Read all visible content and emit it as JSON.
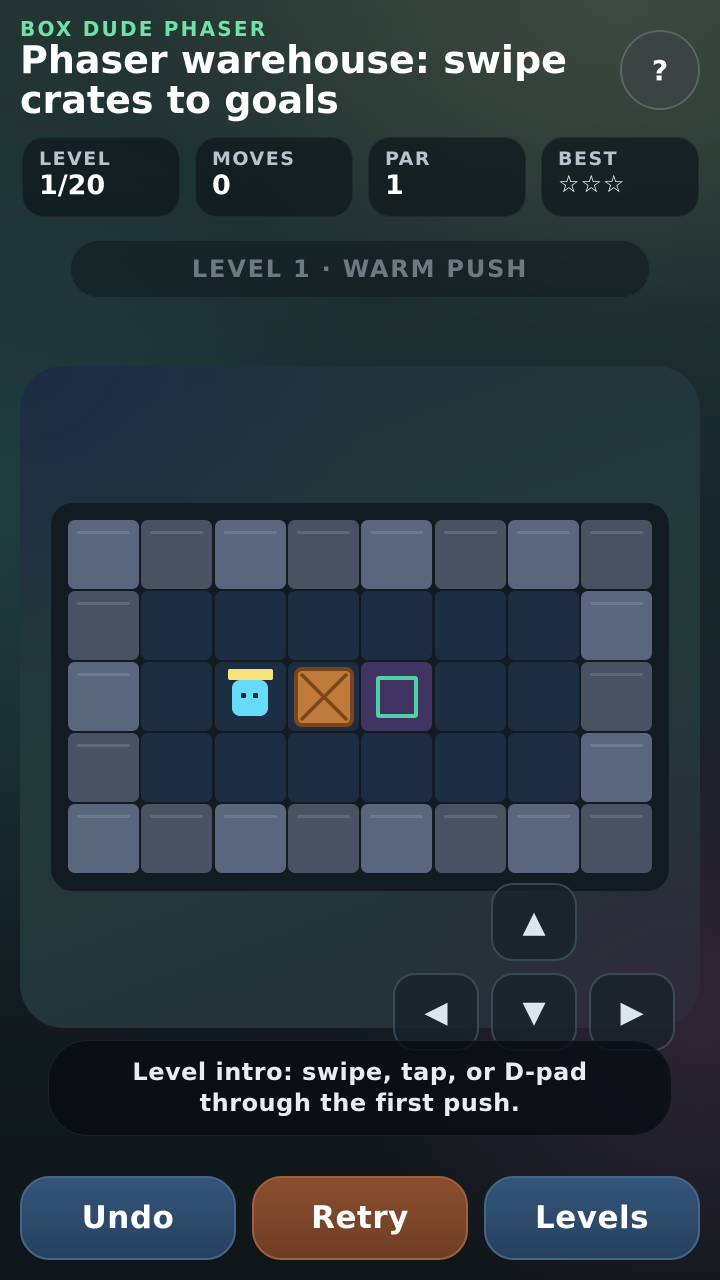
{
  "header": {
    "kicker": "BOX DUDE PHASER",
    "title": "Phaser warehouse: swipe crates to goals",
    "help_label": "?"
  },
  "stats": [
    {
      "label": "LEVEL",
      "value": "1/20"
    },
    {
      "label": "MOVES",
      "value": "0"
    },
    {
      "label": "PAR",
      "value": "1"
    },
    {
      "label": "BEST",
      "value": "☆☆☆"
    }
  ],
  "banner": {
    "text": "LEVEL 1 · WARM PUSH"
  },
  "board": {
    "rows": 5,
    "cols": 8,
    "grid": [
      "########",
      "#......#",
      "#.@$.. #",
      "#......#",
      "########"
    ],
    "legend": {
      "wall": "#",
      "floor": ".",
      "player": "@",
      "crate": "$",
      "goal": "goal"
    },
    "player": {
      "row": 2,
      "col": 2
    },
    "crates": [
      {
        "row": 2,
        "col": 3
      }
    ],
    "goals": [
      {
        "row": 2,
        "col": 4
      }
    ],
    "colors": {
      "wall_light": "#5a657e",
      "wall_dark": "#485263",
      "floor": "#1d2d42",
      "goal_tile": "#3f3462",
      "goal_mark": "#4fd3a6",
      "crate": "#c07a3a",
      "player": "#66dcfa",
      "player_hat": "#f8e27a"
    }
  },
  "dpad": {
    "up": "▲",
    "left": "◀",
    "down": "▼",
    "right": "▶"
  },
  "tip": {
    "text": "Level intro: swipe, tap, or D-pad through the first push."
  },
  "actions": {
    "undo": "Undo",
    "retry": "Retry",
    "levels": "Levels"
  }
}
